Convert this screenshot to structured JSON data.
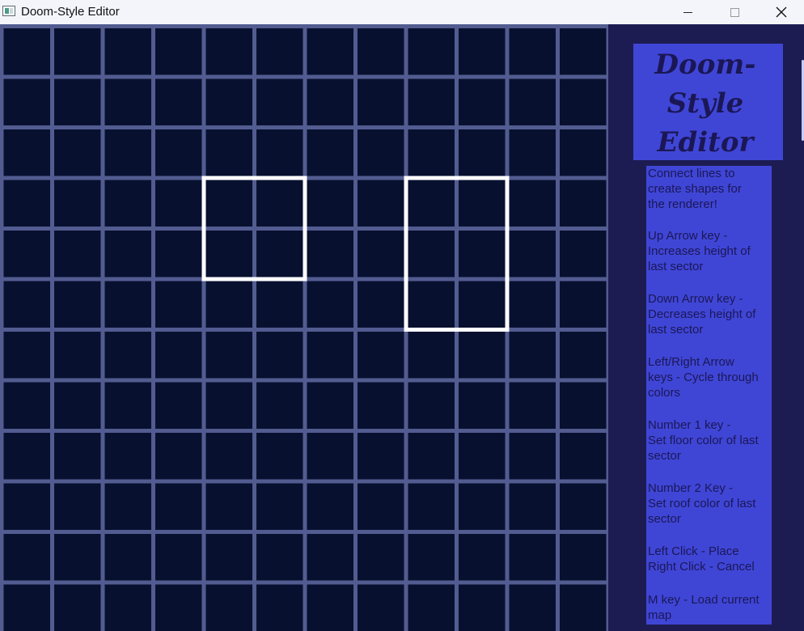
{
  "window": {
    "title": "Doom-Style Editor",
    "minimize_symbol": "",
    "maximize_symbol": "",
    "close_symbol": "✕"
  },
  "colors": {
    "grid_lines": "#525c90",
    "grid_cells": "#081030",
    "shape_outline": "#ffffff",
    "panel_background": "#1d1c52",
    "panel_box": "#3f46d6",
    "panel_text": "#1b1756"
  },
  "editor": {
    "grid": {
      "columns": 12,
      "rows": 12
    },
    "shapes": [
      {
        "type": "rectangle",
        "from_cell": [
          4,
          3
        ],
        "to_cell": [
          6,
          5
        ]
      },
      {
        "type": "rectangle",
        "from_cell": [
          8,
          3
        ],
        "to_cell": [
          10,
          6
        ]
      }
    ]
  },
  "sidebar": {
    "logo_lines": [
      "Doom-",
      "Style",
      "Editor"
    ],
    "help_lines": [
      "Connect lines to",
      "create shapes for",
      "the renderer!",
      "",
      "Up Arrow key -",
      "Increases height of",
      "last sector",
      "",
      "Down Arrow key -",
      "Decreases height of",
      "last sector",
      "",
      "Left/Right Arrow",
      "keys - Cycle through",
      "colors",
      "",
      "Number 1 key -",
      "Set floor color of last",
      "sector",
      "",
      "Number 2 Key -",
      "Set roof color of last",
      "sector",
      "",
      "Left Click - Place",
      "Right Click - Cancel",
      "",
      "M key - Load current",
      "map"
    ]
  }
}
